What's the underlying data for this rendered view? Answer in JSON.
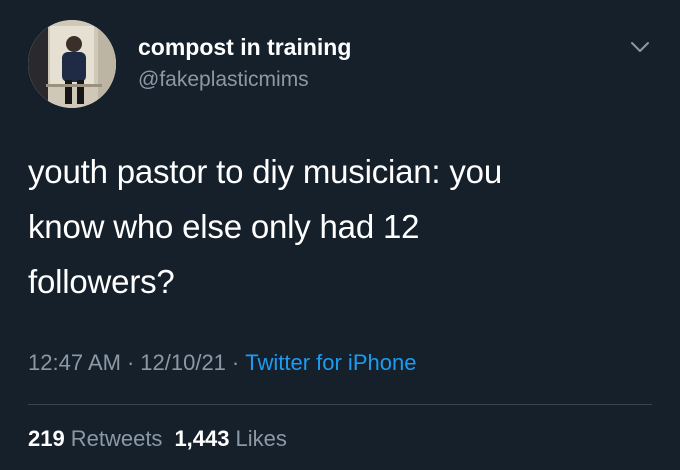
{
  "author": {
    "display_name": "compost in training",
    "handle": "@fakeplasticmims",
    "avatar_icon": "profile-photo"
  },
  "tweet": {
    "text_lines": [
      "youth pastor to diy musician: you",
      "know who else only had 12",
      "followers?"
    ],
    "time": "12:47 AM",
    "separator": "·",
    "date": "12/10/21",
    "source": "Twitter for iPhone"
  },
  "stats": {
    "retweets_count": "219",
    "retweets_label": "Retweets",
    "likes_count": "1,443",
    "likes_label": "Likes"
  },
  "colors": {
    "background": "#15202b",
    "secondary_text": "#8b98a5",
    "link": "#1d9bf0",
    "divider": "#38444d"
  },
  "icons": {
    "more": "chevron-down-icon"
  }
}
